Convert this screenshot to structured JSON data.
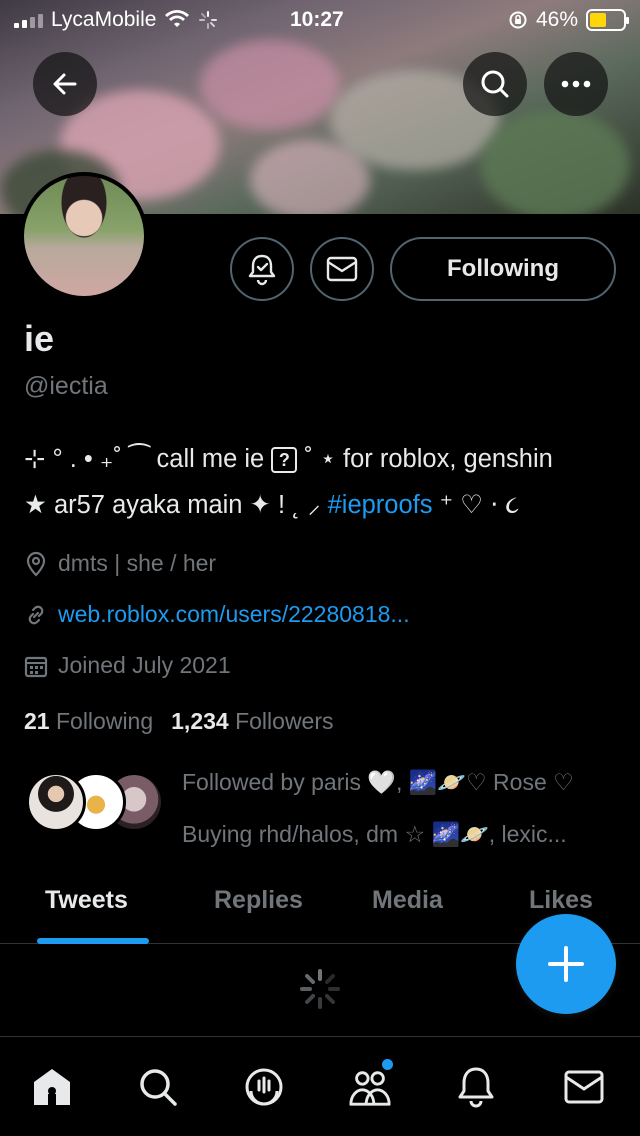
{
  "status_bar": {
    "carrier": "LycaMobile",
    "time": "10:27",
    "battery": "46%",
    "battery_level": 0.46
  },
  "profile": {
    "name": "ie",
    "handle": "@iectia",
    "bio_line1_prefix": "⊹ ° . • ₊˚ ⁀ call me ie",
    "bio_qbox": "?",
    "bio_line1_suffix": "˚ ⋆ for roblox, genshin",
    "bio_line2_prefix": "★ ar57 ayaka main ✦ ! ˛ ⸝",
    "bio_hashtag": "#ieproofs",
    "bio_line2_suffix": "⁺ ♡ ⋅ ૮",
    "location": "dmts | she / her",
    "website": "web.roblox.com/users/22280818...",
    "joined": "Joined July 2021",
    "following_count": "21",
    "following_label": "Following",
    "followers_count": "1,234",
    "followers_label": "Followers",
    "followed_by_line1": "Followed by paris 🤍, 🌌🪐♡ Rose ♡",
    "followed_by_line2": "Buying rhd/halos, dm ☆ 🌌🪐, lexic..."
  },
  "actions": {
    "follow_button": "Following"
  },
  "tabs": [
    {
      "label": "Tweets",
      "active": true
    },
    {
      "label": "Replies",
      "active": false
    },
    {
      "label": "Media",
      "active": false
    },
    {
      "label": "Likes",
      "active": false
    }
  ],
  "icons": {
    "back": "arrow-left-icon",
    "search": "search-icon",
    "more": "more-icon",
    "notify": "bell-check-icon",
    "message": "mail-icon",
    "compose": "plus-icon"
  },
  "bottom_nav": [
    "home-icon",
    "search-icon",
    "spaces-icon",
    "communities-icon",
    "notifications-icon",
    "messages-icon"
  ],
  "colors": {
    "accent": "#1d9bf0",
    "muted": "#71767b",
    "text": "#e7e9ea",
    "background": "#000000"
  }
}
